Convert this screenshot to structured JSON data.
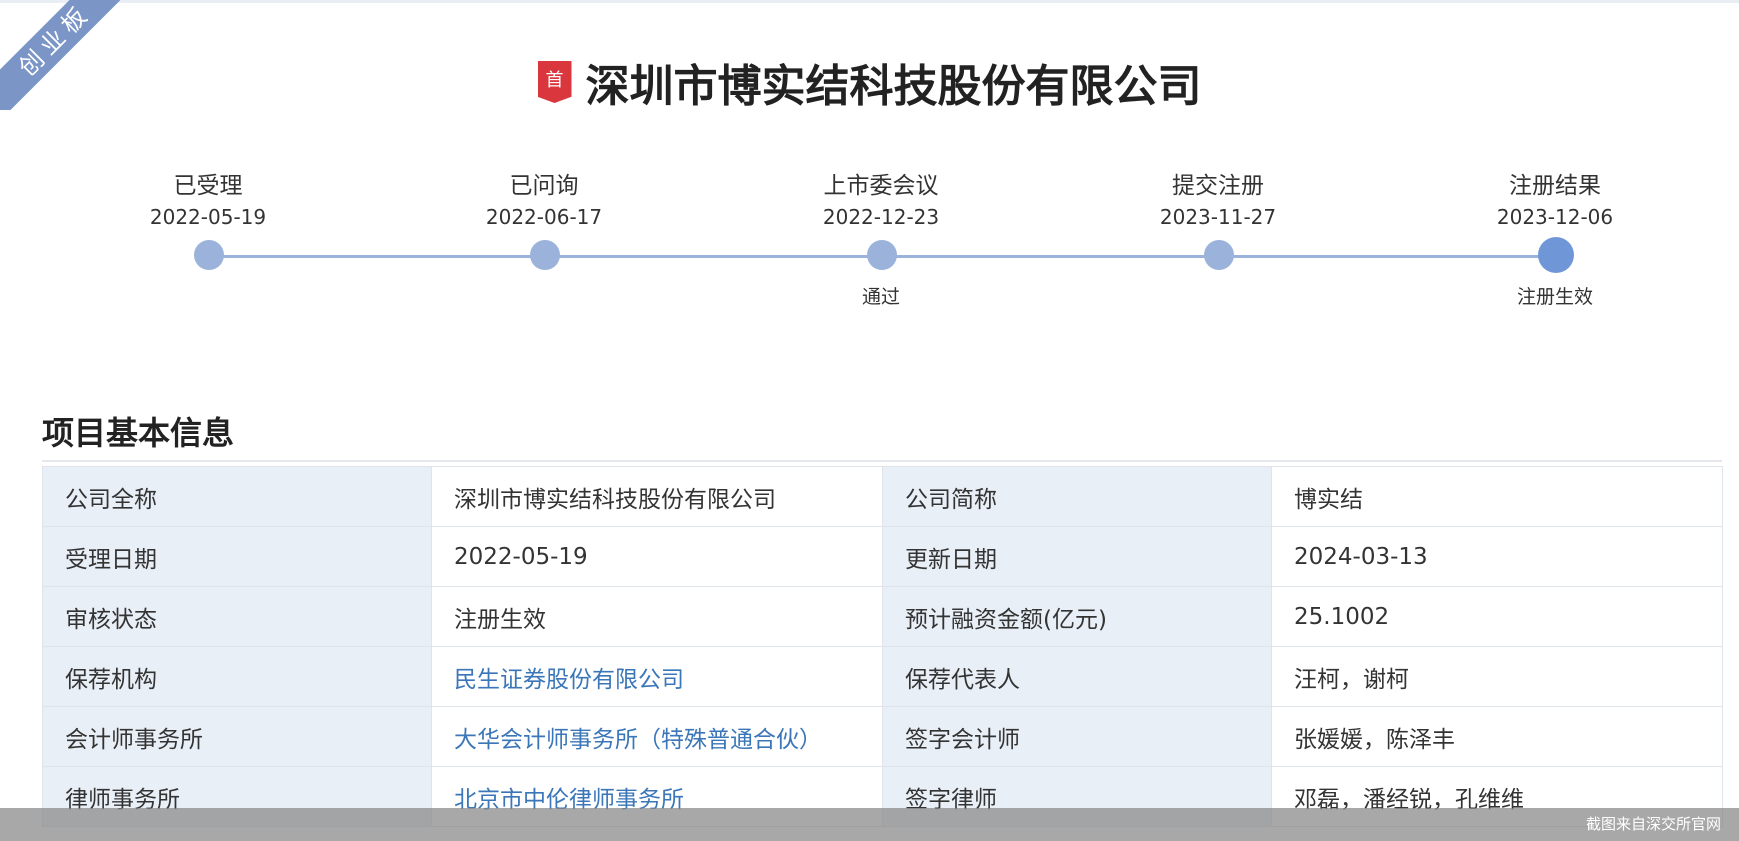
{
  "board_ribbon": "创业板",
  "first_badge": "首",
  "company_title": "深圳市博实结科技股份有限公司",
  "timeline": [
    {
      "name": "已受理",
      "date": "2022-05-19",
      "status": ""
    },
    {
      "name": "已问询",
      "date": "2022-06-17",
      "status": ""
    },
    {
      "name": "上市委会议",
      "date": "2022-12-23",
      "status": "通过"
    },
    {
      "name": "提交注册",
      "date": "2023-11-27",
      "status": ""
    },
    {
      "name": "注册结果",
      "date": "2023-12-06",
      "status": "注册生效"
    }
  ],
  "section_title": "项目基本信息",
  "rows": [
    {
      "l1": "公司全称",
      "v1": "深圳市博实结科技股份有限公司",
      "l2": "公司简称",
      "v2": "博实结"
    },
    {
      "l1": "受理日期",
      "v1": "2022-05-19",
      "l2": "更新日期",
      "v2": "2024-03-13"
    },
    {
      "l1": "审核状态",
      "v1": "注册生效",
      "l2": "预计融资金额(亿元)",
      "v2": "25.1002"
    },
    {
      "l1": "保荐机构",
      "v1": "民生证券股份有限公司",
      "l2": "保荐代表人",
      "v2": "汪柯，谢柯"
    },
    {
      "l1": "会计师事务所",
      "v1": "大华会计师事务所（特殊普通合伙）",
      "l2": "签字会计师",
      "v2": "张媛媛，陈泽丰"
    },
    {
      "l1": "律师事务所",
      "v1": "北京市中伦律师事务所",
      "l2": "签字律师",
      "v2": "邓磊，潘经锐，孔维维"
    }
  ],
  "footer_note": "截图来自深交所官网",
  "colors": {
    "accent": "#6f97d8",
    "link": "#3a76b8",
    "ribbon": "#7a95c6",
    "badge": "#d9363e",
    "label_bg": "#e9eff7"
  }
}
